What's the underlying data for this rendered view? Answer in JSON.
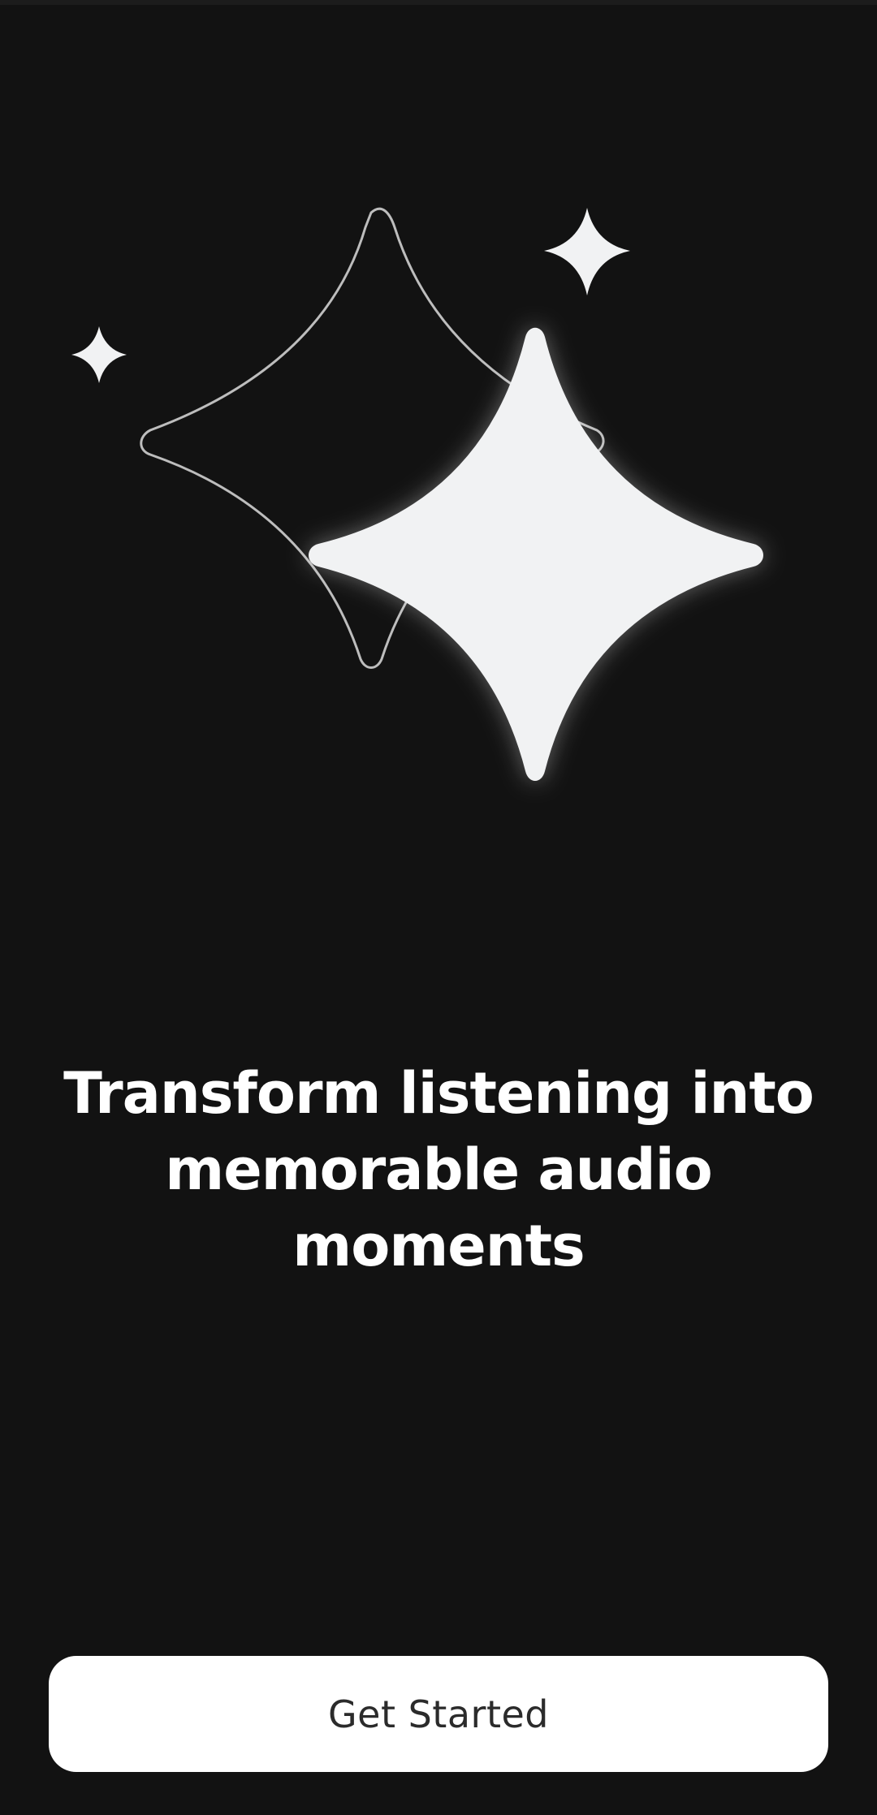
{
  "onboarding": {
    "headline": "Transform listening into memorable audio moments",
    "cta_label": "Get Started"
  },
  "illustration": {
    "icons": [
      "sparkle-large-filled-icon",
      "sparkle-outline-icon",
      "sparkle-small-icon"
    ]
  },
  "colors": {
    "background": "#121212",
    "sparkle_fill": "#f1f2f3",
    "sparkle_outline": "#bdbdbd",
    "text": "#ffffff",
    "button_background": "#ffffff",
    "button_text": "#2b2b2b"
  }
}
